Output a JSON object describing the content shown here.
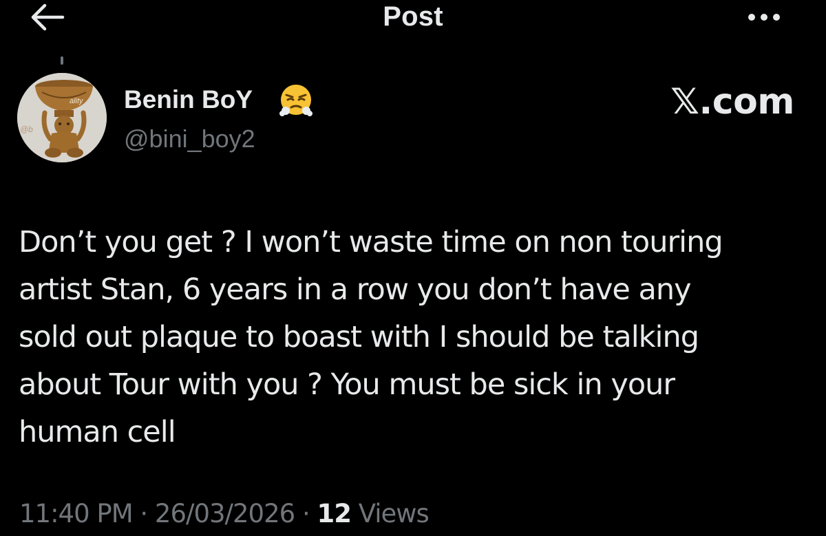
{
  "header": {
    "title": "Post",
    "back_icon": "arrow-left-icon",
    "more_icon": "more-horizontal-icon"
  },
  "author": {
    "name": "Benin BoY",
    "handle": "@bini_boy2",
    "emoji": "face-with-steam-from-nose",
    "avatar_watermark": "@b",
    "avatar_overlay": "ality"
  },
  "watermark": "𝕏.com",
  "post": {
    "text": "Don’t you get ? I won’t waste time on non touring\nartist Stan, 6 years in a row you don’t have any\nsold out plaque to boast with I should be talking\nabout Tour with you ? You must be sick in your\nhuman cell"
  },
  "meta": {
    "time": "11:40 PM",
    "separator": "·",
    "date": "26/03/2026",
    "views_count": "12",
    "views_label": "Views"
  },
  "colors": {
    "background": "#000000",
    "primary_text": "#e7e9ea",
    "secondary_text": "#71767b"
  }
}
